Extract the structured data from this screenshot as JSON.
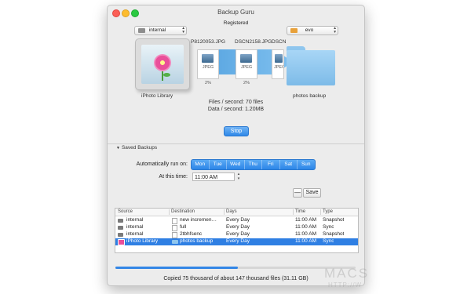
{
  "window": {
    "title": "Backup Guru",
    "subtitle": "Registered"
  },
  "source": {
    "volume": "internal",
    "name": "iPhoto Library"
  },
  "destination": {
    "volume": "evo",
    "name": "photos backup"
  },
  "transfer": {
    "files": [
      {
        "name": "P8120053.JPG",
        "type": "JPEG",
        "percent": "2%"
      },
      {
        "name": "DSCN2158.JPG",
        "type": "JPEG",
        "percent": "2%"
      },
      {
        "name": "DSCN",
        "type": "JPEG"
      }
    ],
    "files_per_second": "Files / second: 70 files",
    "data_per_second": "Data / second: 1.20MB",
    "stop_label": "Stop"
  },
  "saved_backups": {
    "label": "Saved Backups",
    "run_on_label": "Automatically run on:",
    "days": [
      "Mon",
      "Tue",
      "Wed",
      "Thu",
      "Fri",
      "Sat",
      "Sun"
    ],
    "time_label": "At this time:",
    "time_value": "11:00 AM",
    "minus_label": "—",
    "save_label": "Save",
    "columns": [
      "Source",
      "Destination",
      "Days",
      "Time",
      "Type"
    ],
    "rows": [
      {
        "source": "internal",
        "destination": "new incremen…",
        "days": "Every Day",
        "time": "11:00 AM",
        "type": "Snapshot",
        "selected": false
      },
      {
        "source": "internal",
        "destination": "full",
        "days": "Every Day",
        "time": "11:00 AM",
        "type": "Sync",
        "selected": false
      },
      {
        "source": "internal",
        "destination": "2tbhfsenc",
        "days": "Every Day",
        "time": "11:00 AM",
        "type": "Snapshot",
        "selected": false
      },
      {
        "source": "iPhoto Library",
        "destination": "photos backup",
        "days": "Every Day",
        "time": "11:00 AM",
        "type": "Sync",
        "selected": true
      }
    ]
  },
  "progress": {
    "fraction": 0.51
  },
  "status_text": "Copied 75 thousand of about 147 thousand files (31.11 GB)",
  "watermark": {
    "text": "MACS",
    "sub": "HTTP://W"
  },
  "colors": {
    "accent": "#2f7fe3",
    "selection": "#2f7fe3",
    "close": "#fb5f57",
    "minimize": "#fdbc2e",
    "maximize": "#2ac941"
  }
}
